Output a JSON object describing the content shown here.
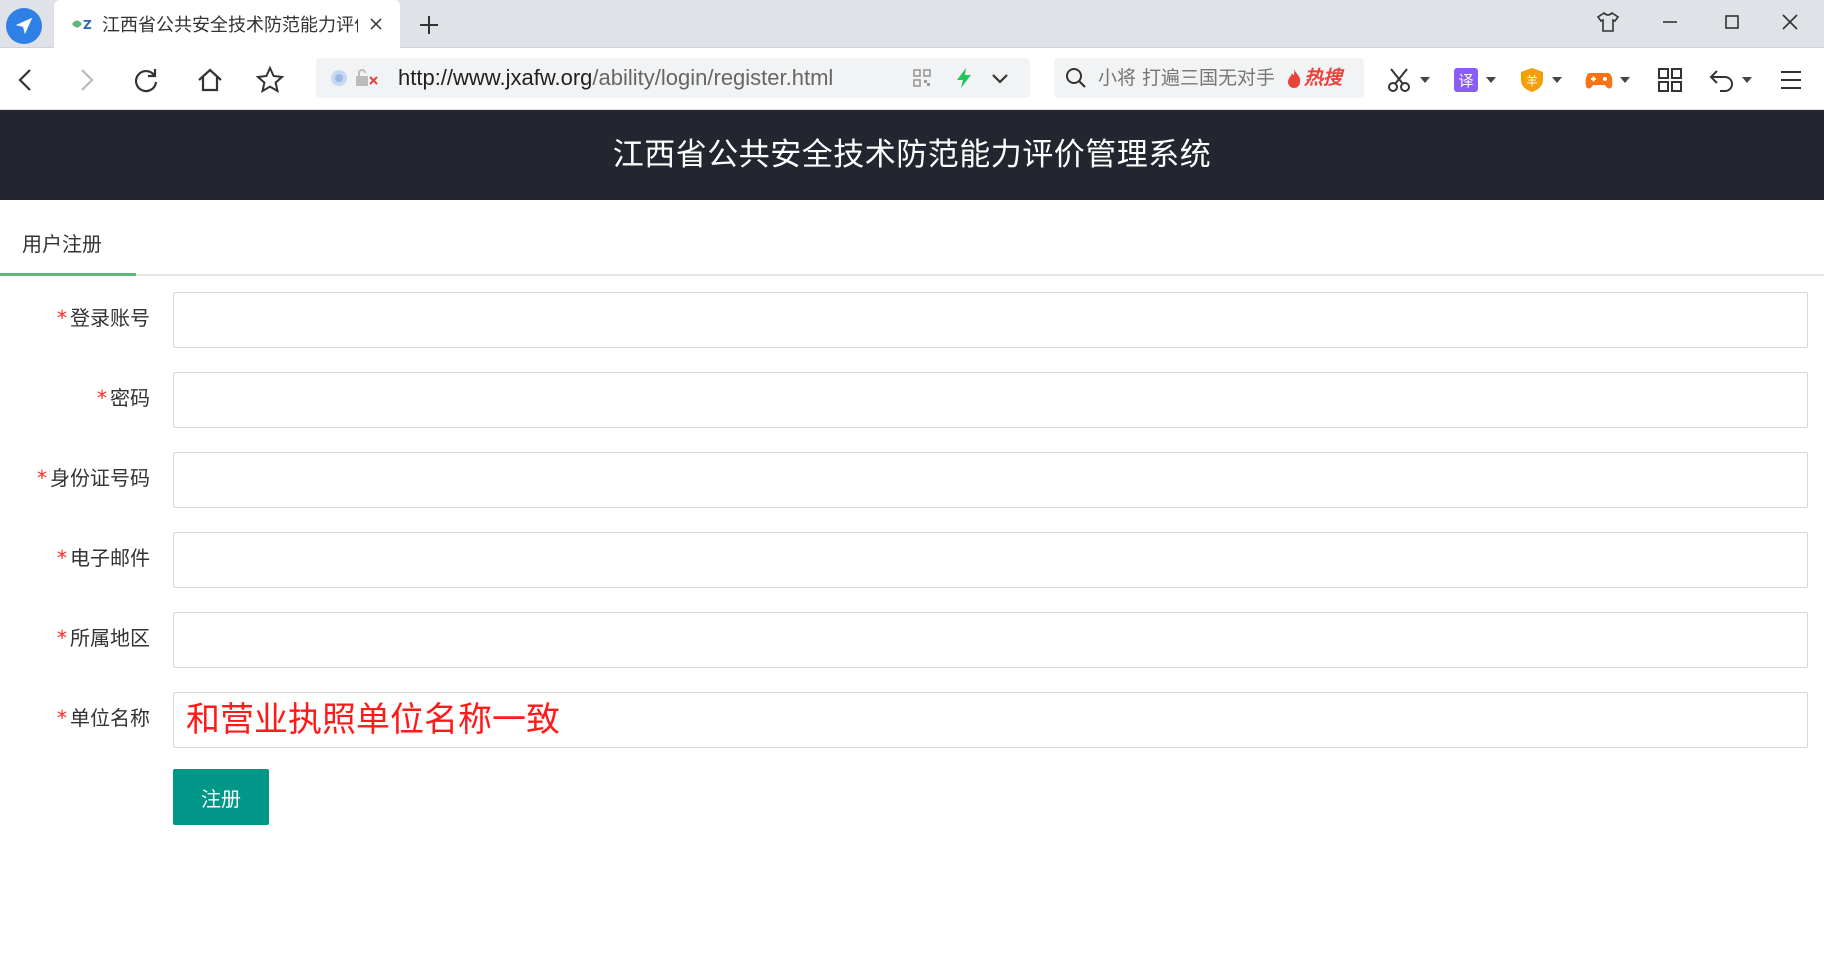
{
  "browser": {
    "tab_title": "江西省公共安全技术防范能力评价",
    "url_host": "http://www.jxafw.org",
    "url_path": "/ability/login/register.html",
    "search_text": "小将 打遍三国无对手",
    "hot_label": "热搜",
    "ext_translate_label": "译",
    "ext_shield_label": "羊"
  },
  "header": {
    "title": "江西省公共安全技术防范能力评价管理系统"
  },
  "tabs": [
    {
      "label": "用户注册",
      "active": true
    }
  ],
  "form": {
    "required_mark": "*",
    "fields": [
      {
        "label": "登录账号",
        "value": "",
        "placeholder": ""
      },
      {
        "label": "密码",
        "value": "",
        "placeholder": ""
      },
      {
        "label": "身份证号码",
        "value": "",
        "placeholder": ""
      },
      {
        "label": "电子邮件",
        "value": "",
        "placeholder": ""
      },
      {
        "label": "所属地区",
        "value": "",
        "placeholder": ""
      },
      {
        "label": "单位名称",
        "value": "",
        "placeholder": "和营业执照单位名称一致"
      }
    ],
    "submit_label": "注册"
  },
  "colors": {
    "header_bg": "#23262e",
    "tab_active_underline": "#5fb878",
    "submit_bg": "#009688",
    "required_red": "#ff2222",
    "placeholder_red": "#ff1a1a"
  },
  "icons": {
    "browser": "paper-plane-icon",
    "favicon": "site-favicon-icon",
    "nav": [
      "back-icon",
      "forward-icon",
      "reload-icon",
      "home-icon",
      "star-icon"
    ],
    "extensions": [
      "scissors-icon",
      "translate-icon",
      "shield-icon",
      "gamepad-icon",
      "grid-icon",
      "undo-icon",
      "menu-icon"
    ]
  }
}
